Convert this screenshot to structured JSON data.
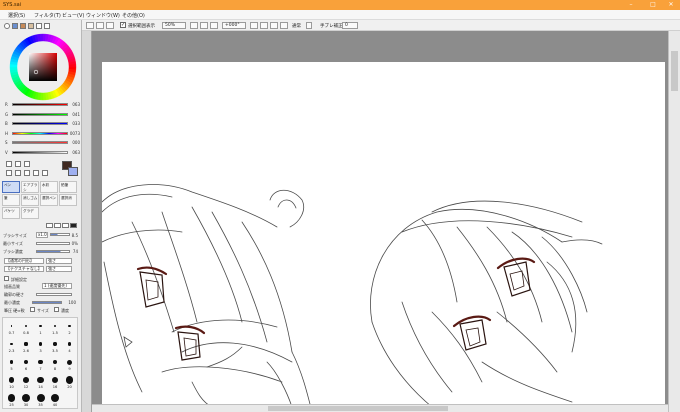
{
  "window": {
    "title": "SYS.sai"
  },
  "menu": {
    "items": [
      "選択(S)",
      "フィルタ(T)",
      "ビュー(V)",
      "ウィンドウ(W)",
      "その他(O)"
    ]
  },
  "toolbar": {
    "selection_label": "選択範囲表示",
    "zoom_value": "50%",
    "rotation_value": "+000°",
    "normal_label": "通常",
    "stabilizer_label": "手ブレ補正",
    "stabilizer_value": "0"
  },
  "color_sliders": [
    {
      "label": "R",
      "value": "063"
    },
    {
      "label": "G",
      "value": "041"
    },
    {
      "label": "B",
      "value": "033"
    },
    {
      "label": "H",
      "value": "0073"
    },
    {
      "label": "S",
      "value": "000"
    },
    {
      "label": "V",
      "value": "063"
    }
  ],
  "tools": {
    "row1": [
      "ペン",
      "エアブラシ",
      "水彩",
      "鉛筆"
    ],
    "row2": [
      "筆",
      "消しゴム",
      "選択ペン",
      "選択消"
    ],
    "row3": [
      "バケツ",
      "グラデ"
    ]
  },
  "brush": {
    "size_label": "ブラシサイズ",
    "size_multiplier": "x1.0",
    "size_value": "8.5",
    "min_size_label": "最小サイズ",
    "min_size_value": "0%",
    "density_label": "ブラシ濃度",
    "density_value": "74",
    "option_a_label": "【通常の円形】",
    "option_a_value": "強さ",
    "option_b_label": "【テクスチャなし】",
    "option_b_value": "強さ",
    "advanced_label": "詳細設定",
    "quality_label": "描画品質",
    "quality_value": "1 (速度優先)",
    "edge_label": "輪郭の硬さ",
    "pressure_label": "最小濃度",
    "pressure_value": "100",
    "pressure_toggle_label": "筆圧 硬⇔軟",
    "pressure_size": "サイズ",
    "pressure_density": "濃度"
  },
  "brush_presets": [
    "0.7",
    "0.8",
    "1",
    "1.5",
    "2",
    "2.3",
    "2.6",
    "3",
    "3.5",
    "4",
    "5",
    "6",
    "7",
    "8",
    "9",
    "10",
    "12",
    "14",
    "16",
    "20",
    "25",
    "30",
    "35",
    "40"
  ],
  "colors": {
    "title_bar": "#f9a13a",
    "primary_color": "#3f2921",
    "secondary_color": "#ffffff",
    "workspace": "#8c8c8c"
  }
}
